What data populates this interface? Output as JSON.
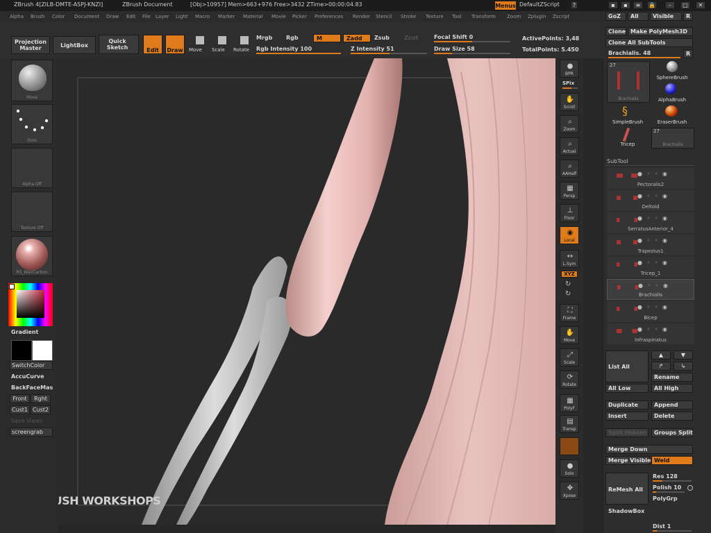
{
  "titlebar": {
    "app": "ZBrush 4[ZILB-DMTE-ASPJ-KNZI]",
    "document": "ZBrush Document",
    "stats": "[Obj>10957] Mem>663+976 Free>3432 ZTime>00:00:04.83",
    "menus": "Menus",
    "script": "DefaultZScript"
  },
  "menubar": [
    "Alpha",
    "Brush",
    "Color",
    "Document",
    "Draw",
    "Edit",
    "File",
    "Layer",
    "Light",
    "Macro",
    "Marker",
    "Material",
    "Movie",
    "Picker",
    "Preferences",
    "Render",
    "Stencil",
    "Stroke",
    "Texture",
    "Tool",
    "Transform",
    "Zoom",
    "Zplugin",
    "Zscript"
  ],
  "toolbar": {
    "projection_master": "Projection Master",
    "lightbox": "LightBox",
    "quick_sketch": "Quick Sketch",
    "edit": "Edit",
    "draw": "Draw",
    "move": "Move",
    "scale": "Scale",
    "rotate": "Rotate",
    "mrgb": "Mrgb",
    "rgb": "Rgb",
    "m": "M",
    "zadd": "Zadd",
    "zsub": "Zsub",
    "zcut": "Zcut",
    "rgb_intensity": "Rgb Intensity 100",
    "z_intensity": "Z Intensity 51",
    "focal_shift": "Focal Shift 0",
    "draw_size": "Draw Size 58",
    "active_points": "ActivePoints: 3,48",
    "total_points": "TotalPoints: 5.450"
  },
  "leftshelf": {
    "move": "Move",
    "dots": "Dots",
    "alpha_off": "Alpha Off",
    "texture_off": "Texture Off",
    "material": "RS_WaxCarbon",
    "gradient": "Gradient",
    "switchcolor": "SwitchColor",
    "accucurve": "AccuCurve",
    "backfacemask": "BackFaceMas",
    "front": "Front",
    "right": "Rght",
    "cust1": "Cust1",
    "cust2": "Cust2",
    "save_views": "Save Views",
    "screengrab": "screengrab"
  },
  "watermark": "ZBRUSH WORKSHOPS",
  "rightshelf": [
    "BPR",
    "SPix",
    "Scroll",
    "Zoom",
    "Actual",
    "AAHalf",
    "Persp",
    "Floor",
    "Local",
    "L.Sym",
    "XYZ",
    "Frame",
    "Move",
    "Scale",
    "Rotate",
    "PolyF",
    "Transp",
    "Ghost",
    "Solo",
    "Xpose"
  ],
  "panel": {
    "goz": "GoZ",
    "all": "All",
    "visible": "Visible",
    "r": "R",
    "clone": "Clone",
    "make_polymesh": "Make PolyMesh3D",
    "clone_all": "Clone All SubTools",
    "tool_name": "Brachialis. 48",
    "tool_count_1": "27",
    "tool_caption_1": "Brachialis",
    "sphere_brush": "SphereBrush",
    "alpha_brush": "AlphaBrush",
    "simple_brush": "SimpleBrush",
    "eraser_brush": "EraserBrush",
    "tricep": "Tricep",
    "tool_count_2": "27",
    "tool_caption_2": "Brachialis",
    "subtool_header": "SubTool",
    "subtools": [
      "Pectoralis2",
      "Deltoid",
      "SerratusAnterior_4",
      "Trapezius1",
      "Tricep_1",
      "Brachialis",
      "Bicep",
      "Infraspinatus"
    ],
    "list_all": "List All",
    "rename": "Rename",
    "all_low": "All Low",
    "all_high": "All High",
    "duplicate": "Duplicate",
    "append": "Append",
    "insert": "Insert",
    "delete": "Delete",
    "split_hidden": "Split Hidden",
    "groups_split": "Groups Split",
    "merge_down": "Merge Down",
    "merge_visible": "Merge Visible",
    "weld": "Weld",
    "remesh_all": "ReMesh All",
    "res": "Res 128",
    "polish": "Polish 10",
    "polygrp": "PolyGrp",
    "shadowbox": "ShadowBox",
    "dist": "Dist 1"
  },
  "colors": {
    "accent": "#e07b1b",
    "skin": "#e9b9b6",
    "bone": "#c9c9c9"
  }
}
